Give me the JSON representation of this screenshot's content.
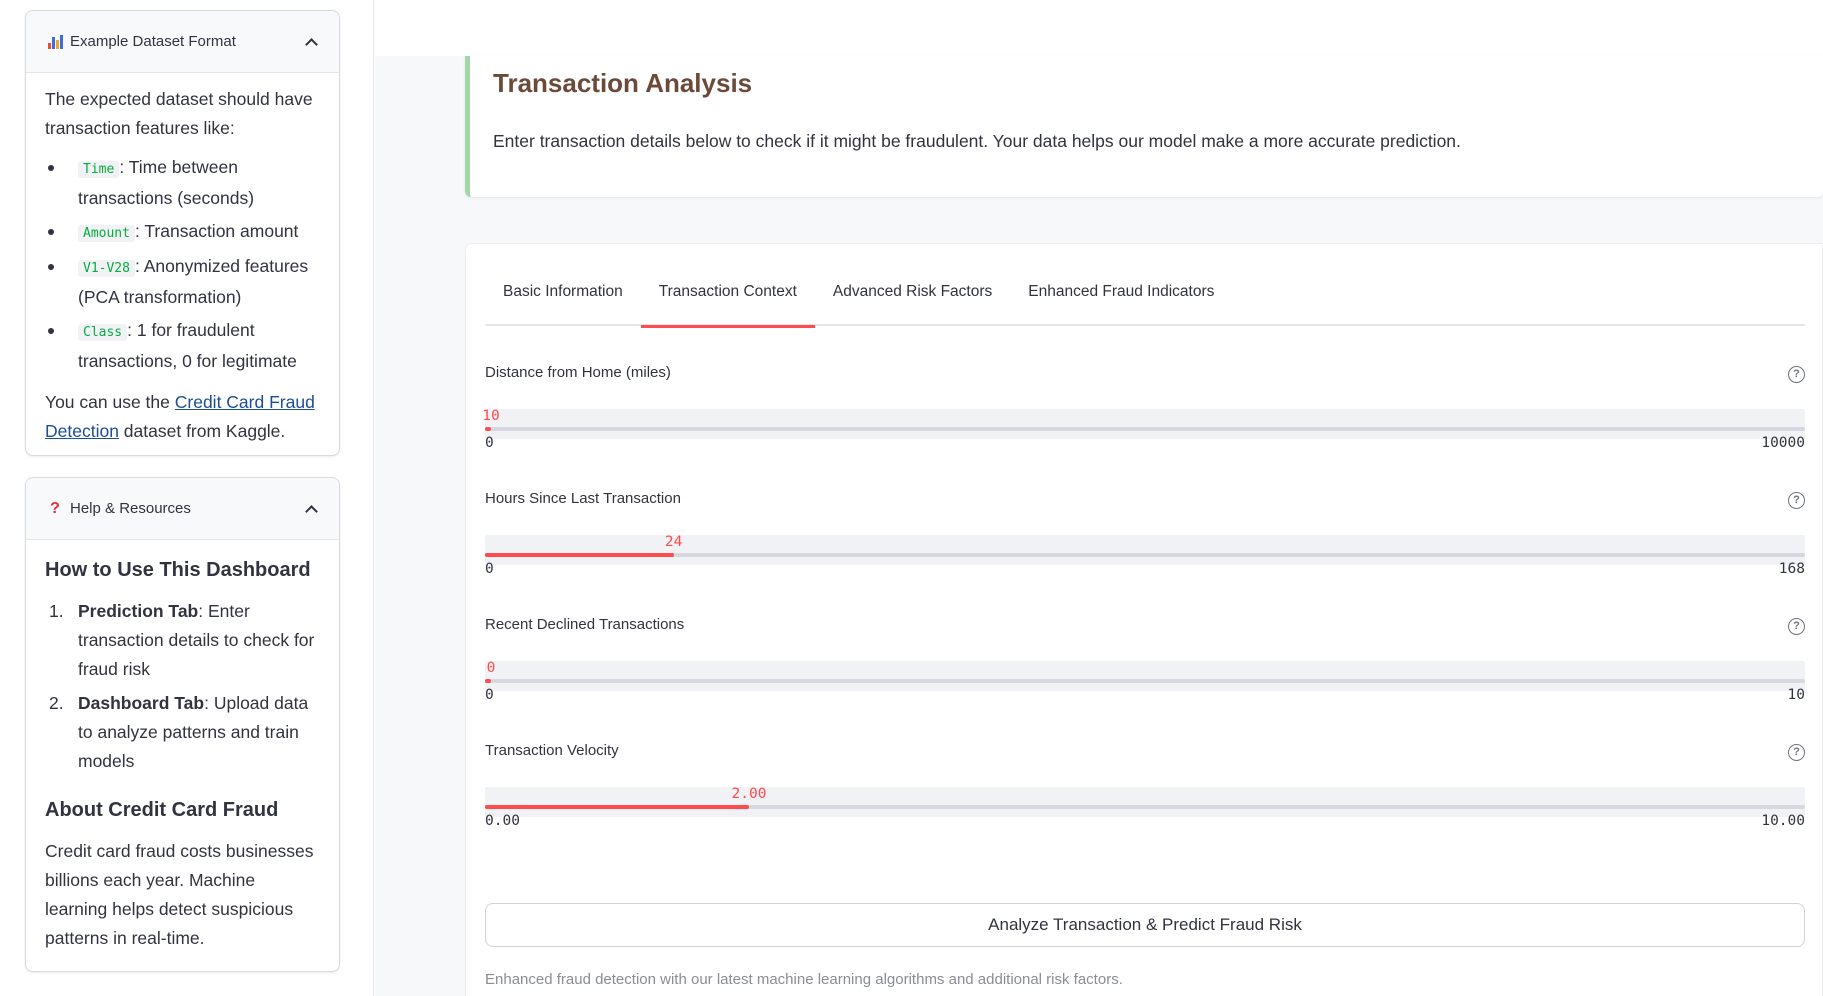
{
  "sidebar": {
    "dataset_expander": {
      "title": "Example Dataset Format",
      "intro": "The expected dataset should have transaction features like:",
      "features": [
        {
          "code": "Time",
          "desc": ": Time between transactions (seconds)"
        },
        {
          "code": "Amount",
          "desc": ": Transaction amount"
        },
        {
          "code": "V1-V28",
          "desc": ": Anonymized features (PCA transformation)"
        },
        {
          "code": "Class",
          "desc": ": 1 for fraudulent transactions, 0 for legitimate"
        }
      ],
      "footer_prefix": "You can use the ",
      "footer_link": "Credit Card Fraud Detection",
      "footer_suffix": " dataset from Kaggle.",
      "icon": "bar-chart-icon"
    },
    "help_expander": {
      "title": "Help & Resources",
      "icon": "question-icon",
      "howto_heading": "How to Use This Dashboard",
      "steps": [
        {
          "num": "1.",
          "bold": "Prediction Tab",
          "text": ": Enter transaction details to check for fraud risk"
        },
        {
          "num": "2.",
          "bold": "Dashboard Tab",
          "text": ": Upload data to analyze patterns and train models"
        }
      ],
      "about_heading": "About Credit Card Fraud",
      "about_text": "Credit card fraud costs businesses billions each year. Machine learning helps detect suspicious patterns in real-time."
    }
  },
  "main": {
    "title": "Transaction Analysis",
    "description": "Enter transaction details below to check if it might be fraudulent. Your data helps our model make a more accurate prediction.",
    "tabs": [
      {
        "label": "Basic Information",
        "active": false
      },
      {
        "label": "Transaction Context",
        "active": true
      },
      {
        "label": "Advanced Risk Factors",
        "active": false
      },
      {
        "label": "Enhanced Fraud Indicators",
        "active": false
      }
    ],
    "sliders": [
      {
        "label": "Distance from Home (miles)",
        "value": "10",
        "min": "0",
        "max": "10000",
        "fraction": 0.001
      },
      {
        "label": "Hours Since Last Transaction",
        "value": "24",
        "min": "0",
        "max": "168",
        "fraction": 0.1429
      },
      {
        "label": "Recent Declined Transactions",
        "value": "0",
        "min": "0",
        "max": "10",
        "fraction": 0.0
      },
      {
        "label": "Transaction Velocity",
        "value": "2.00",
        "min": "0.00",
        "max": "10.00",
        "fraction": 0.2
      }
    ],
    "analyze_button": "Analyze Transaction & Predict Fraud Risk",
    "caption": "Enhanced fraud detection with our latest machine learning algorithms and additional risk factors."
  },
  "colors": {
    "accent": "#ff4b4b",
    "title_brown": "#6b4a3a",
    "card_border_green": "#a5d6a7",
    "code_green": "#09ab3b",
    "link_blue": "#1c4e96"
  }
}
